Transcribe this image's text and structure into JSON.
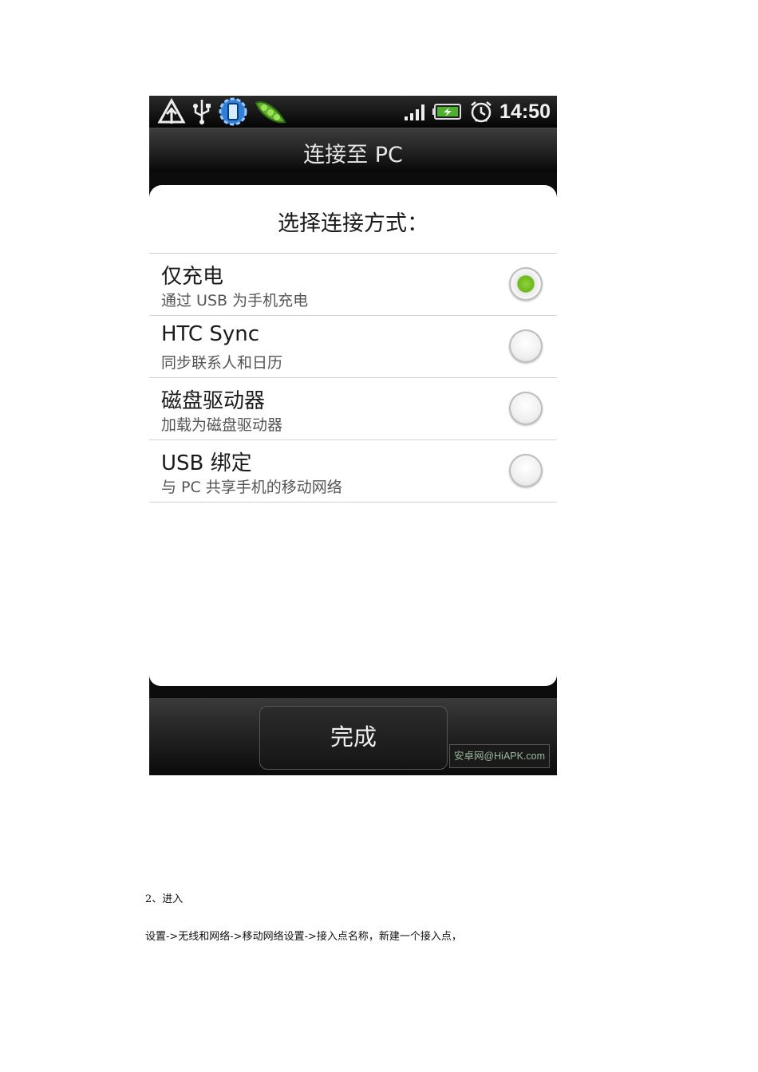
{
  "status_bar": {
    "time": "14:50",
    "icons_left": [
      "signal-alert-icon",
      "usb-icon",
      "phone-sync-icon",
      "peapod-icon"
    ],
    "icons_right": [
      "signal-strength-icon",
      "battery-charging-icon",
      "alarm-clock-icon"
    ]
  },
  "titlebar": {
    "title": "连接至 PC"
  },
  "dialog": {
    "prompt": "选择连接方式：",
    "options": [
      {
        "title": "仅充电",
        "subtitle": "通过 USB 为手机充电",
        "selected": true
      },
      {
        "title": "HTC Sync",
        "subtitle": "同步联系人和日历",
        "selected": false
      },
      {
        "title": "磁盘驱动器",
        "subtitle": "加载为磁盘驱动器",
        "selected": false
      },
      {
        "title": "USB 绑定",
        "subtitle": "与 PC 共享手机的移动网络",
        "selected": false
      }
    ]
  },
  "bottom": {
    "done_label": "完成",
    "watermark": "安卓网@HiAPK.com"
  },
  "document": {
    "step": "2、进入",
    "path": "设置->无线和网络->移动网络设置->接入点名称，新建一个接入点，"
  },
  "colors": {
    "radio_selected": "#6cb81e",
    "bar_dark": "#0c0c0c"
  }
}
